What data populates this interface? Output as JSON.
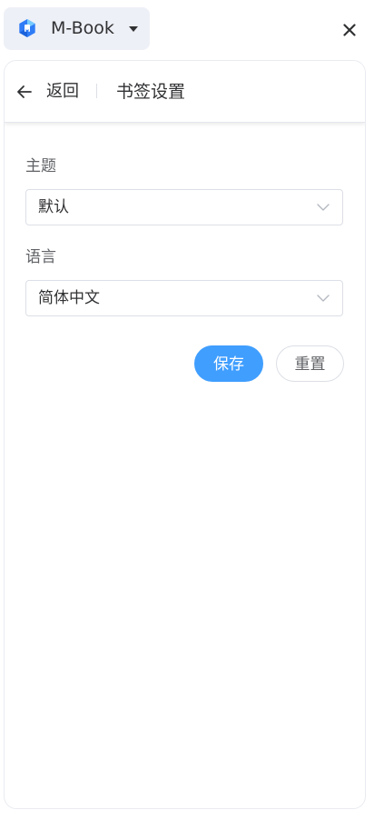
{
  "app": {
    "name": "M-Book",
    "logo_icon": "m-book-logo-icon",
    "dropdown_icon": "caret-down-icon",
    "close_icon": "close-icon"
  },
  "header": {
    "back_label": "返回",
    "back_icon": "arrow-left-icon",
    "title": "书签设置"
  },
  "form": {
    "theme": {
      "label": "主题",
      "value": "默认"
    },
    "language": {
      "label": "语言",
      "value": "简体中文"
    }
  },
  "actions": {
    "save_label": "保存",
    "reset_label": "重置"
  },
  "colors": {
    "primary": "#409eff",
    "switcher_bg": "#eef0f7",
    "logo_blue": "#2f7cf6",
    "logo_light": "#7fd3ff"
  }
}
